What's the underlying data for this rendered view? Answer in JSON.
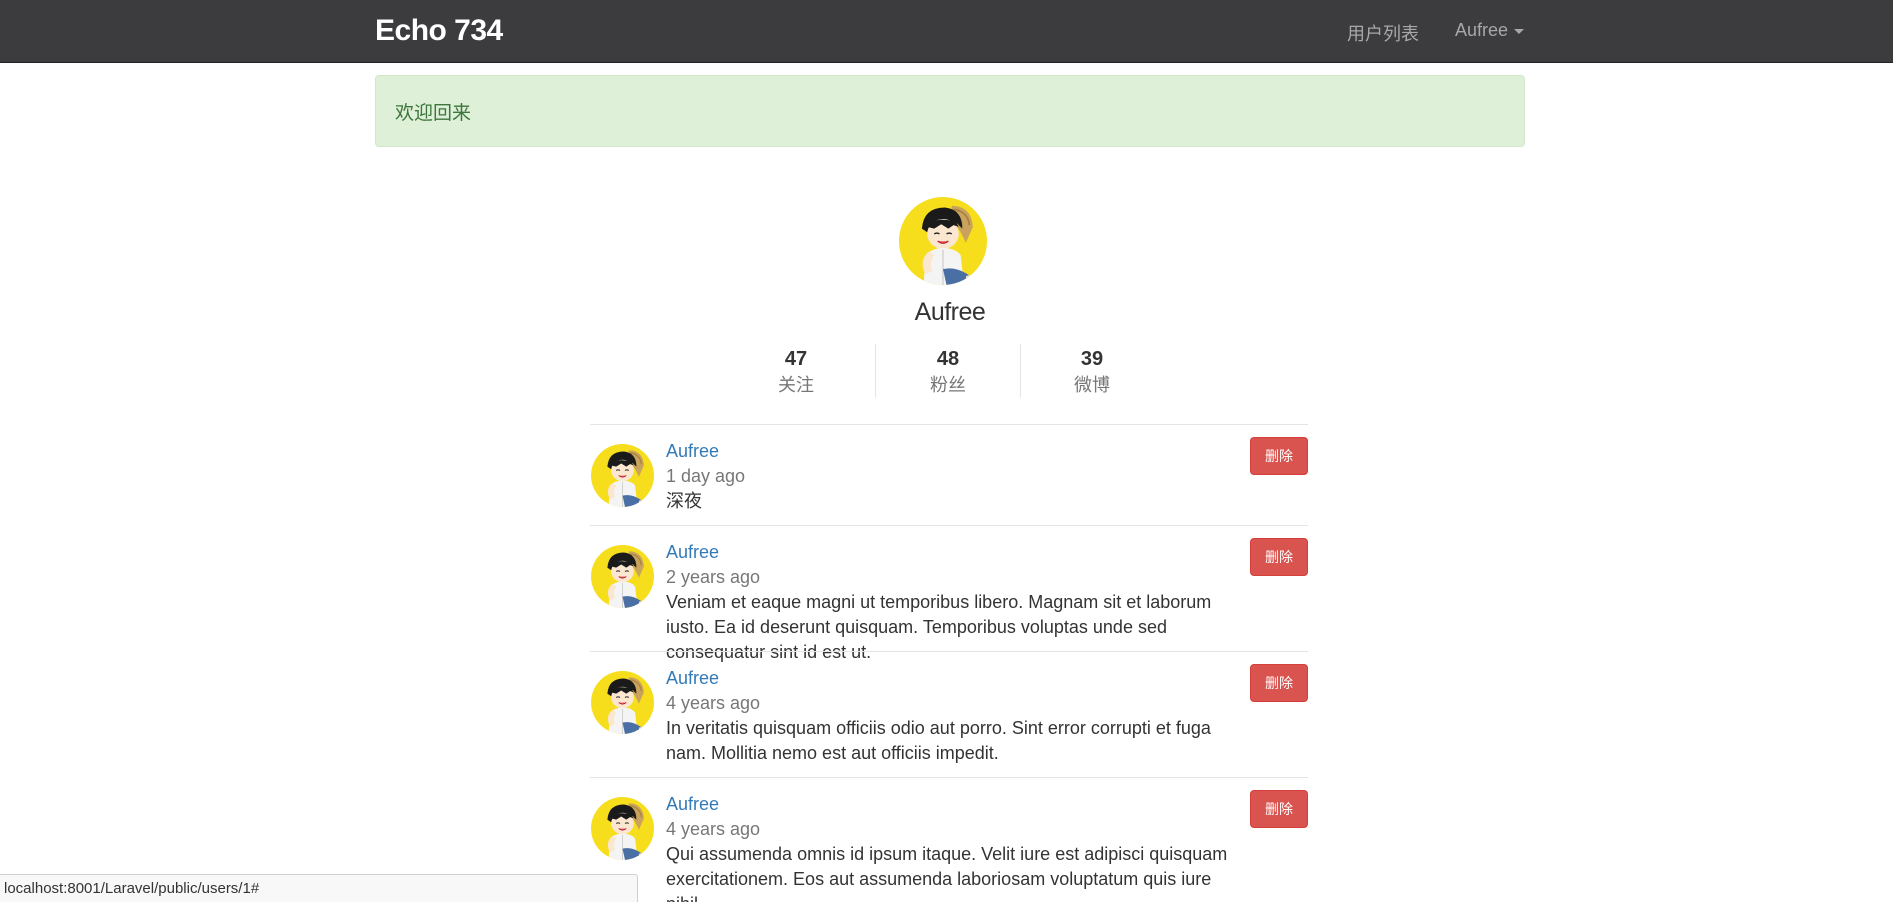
{
  "navbar": {
    "brand": "Echo 734",
    "users_link": "用户列表",
    "user_menu": "Aufree"
  },
  "alert": {
    "message": "欢迎回来"
  },
  "profile": {
    "name": "Aufree",
    "stats": {
      "following_count": "47",
      "following_label": "关注",
      "followers_count": "48",
      "followers_label": "粉丝",
      "statuses_count": "39",
      "statuses_label": "微博"
    }
  },
  "feed": {
    "delete_label": "删除",
    "items": [
      {
        "user": "Aufree",
        "time": "1 day ago",
        "content": "深夜"
      },
      {
        "user": "Aufree",
        "time": "2 years ago",
        "content": "Veniam et eaque magni ut temporibus libero. Magnam sit et laborum iusto. Ea id deserunt quisquam. Temporibus voluptas unde sed consequatur sint id est ut."
      },
      {
        "user": "Aufree",
        "time": "4 years ago",
        "content": "In veritatis quisquam officiis odio aut porro. Sint error corrupti et fuga nam. Mollitia nemo est aut officiis impedit."
      },
      {
        "user": "Aufree",
        "time": "4 years ago",
        "content": "Qui assumenda omnis id ipsum itaque. Velit iure est adipisci quisquam exercitationem. Eos aut assumenda laboriosam voluptatum quis iure nihil."
      }
    ]
  },
  "status_bar": {
    "url": "localhost:8001/Laravel/public/users/1#"
  },
  "colors": {
    "navbar_bg": "#3c3c3f",
    "alert_bg": "#dff0d8",
    "alert_text": "#3c763d",
    "link": "#337ab7",
    "danger": "#d9534f"
  }
}
